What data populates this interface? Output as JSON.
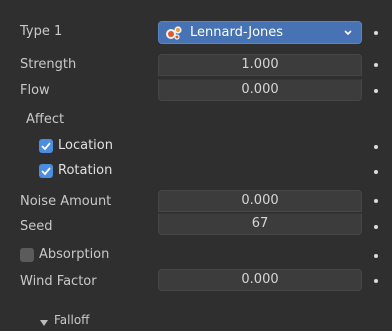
{
  "type1": {
    "label": "Type 1",
    "value": "Lennard-Jones",
    "icon": "lennard-jones-icon"
  },
  "strength": {
    "label": "Strength",
    "value": "1.000"
  },
  "flow": {
    "label": "Flow",
    "value": "0.000"
  },
  "affect": {
    "label": "Affect",
    "location": {
      "label": "Location",
      "checked": true
    },
    "rotation": {
      "label": "Rotation",
      "checked": true
    }
  },
  "noise_amount": {
    "label": "Noise Amount",
    "value": "0.000"
  },
  "seed": {
    "label": "Seed",
    "value": "67"
  },
  "absorption": {
    "label": "Absorption",
    "checked": false
  },
  "wind_factor": {
    "label": "Wind Factor",
    "value": "0.000"
  },
  "falloff": {
    "label": "Falloff",
    "icon": "triangle-down-icon"
  },
  "colors": {
    "accent": "#4772b3",
    "checkbox_on": "#4b8de0",
    "background": "#2f2f2f",
    "field": "#3c3c3c"
  }
}
